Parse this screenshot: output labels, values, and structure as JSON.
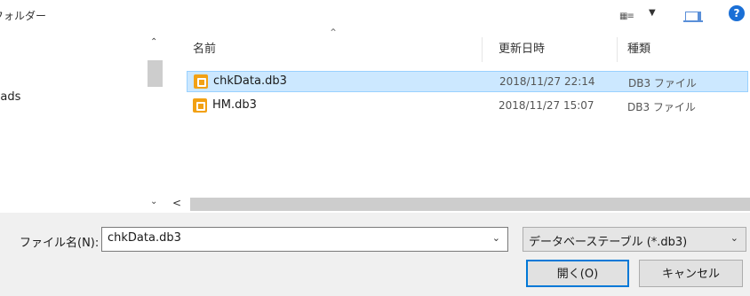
{
  "toolbar": {
    "new_folder_label": "新しいフォルダー",
    "view_icon": "view-options-icon",
    "pane_icon": "preview-pane-icon",
    "help_icon": "help-icon",
    "help_glyph": "?"
  },
  "nav": {
    "items": [
      {
        "label": "Downloads"
      }
    ]
  },
  "file_list": {
    "columns": {
      "name": "名前",
      "date": "更新日時",
      "type": "種類"
    },
    "rows": [
      {
        "name": "chkData.db3",
        "date": "2018/11/27 22:14",
        "type": "DB3 ファイル",
        "selected": true
      },
      {
        "name": "HM.db3",
        "date": "2018/11/27 15:07",
        "type": "DB3 ファイル",
        "selected": false
      }
    ]
  },
  "bottom": {
    "file_name_label": "ファイル名(N):",
    "file_name_value": "chkData.db3",
    "file_type_value": "データベーステーブル (*.db3)",
    "open_button": "開く(O)",
    "cancel_button": "キャンセル"
  },
  "colors": {
    "selection_bg": "#cce8ff",
    "selection_border": "#99d1ff",
    "accent": "#0078d7",
    "file_icon": "#f2a114"
  }
}
